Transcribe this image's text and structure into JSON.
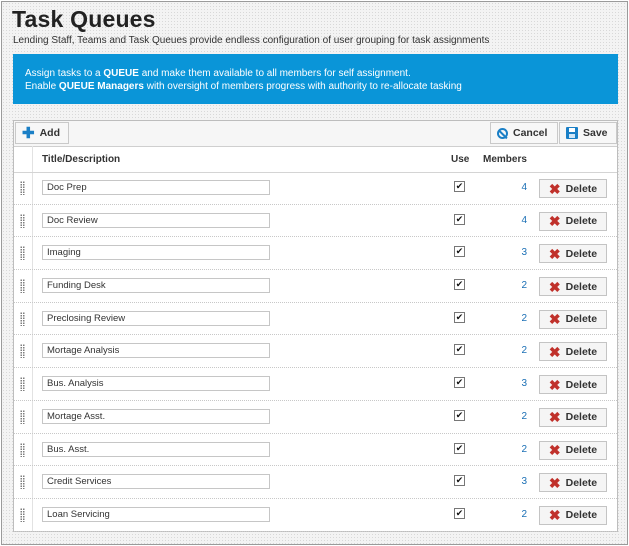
{
  "page": {
    "title": "Task Queues",
    "subtitle": "Lending Staff, Teams and Task Queues provide endless configuration of user grouping for task assignments"
  },
  "banner": {
    "line1_pre": "Assign tasks to a ",
    "line1_bold": "QUEUE",
    "line1_post": " and make them available to all members for self assignment.",
    "line2_pre": "Enable ",
    "line2_bold": "QUEUE Managers",
    "line2_post": " with oversight of members progress with authority to re-allocate tasking"
  },
  "toolbar": {
    "add_label": "Add",
    "cancel_label": "Cancel",
    "save_label": "Save"
  },
  "columns": {
    "title": "Title/Description",
    "use": "Use",
    "members": "Members"
  },
  "delete_label": "Delete",
  "checkmark": "✔",
  "rows": [
    {
      "name": "Doc Prep",
      "use": true,
      "members": "4"
    },
    {
      "name": "Doc Review",
      "use": true,
      "members": "4"
    },
    {
      "name": "Imaging",
      "use": true,
      "members": "3"
    },
    {
      "name": "Funding Desk",
      "use": true,
      "members": "2"
    },
    {
      "name": "Preclosing Review",
      "use": true,
      "members": "2"
    },
    {
      "name": "Mortage Analysis",
      "use": true,
      "members": "2"
    },
    {
      "name": "Bus. Analysis",
      "use": true,
      "members": "3"
    },
    {
      "name": "Mortage Asst.",
      "use": true,
      "members": "2"
    },
    {
      "name": "Bus. Asst.",
      "use": true,
      "members": "2"
    },
    {
      "name": "Credit Services",
      "use": true,
      "members": "3"
    },
    {
      "name": "Loan Servicing",
      "use": true,
      "members": "2"
    }
  ]
}
